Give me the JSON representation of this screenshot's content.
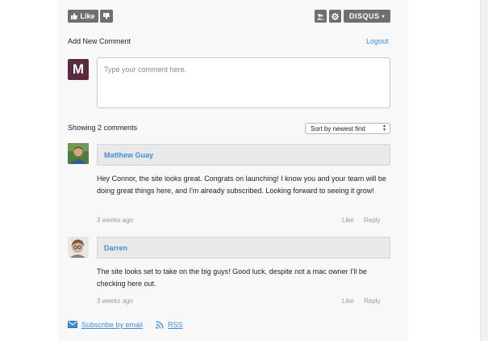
{
  "toolbar": {
    "like_label": "Like",
    "disqus_label": "DISQUS"
  },
  "header": {
    "add_comment": "Add New Comment",
    "logout": "Logout"
  },
  "composer": {
    "avatar_letter": "M",
    "placeholder": "Type your comment here."
  },
  "comments_header": {
    "count_text": "Showing 2 comments",
    "sort_selected": "Sort by newest first"
  },
  "comments": [
    {
      "author": "Matthew Guay",
      "text": "Hey Connor, the site looks great. Congrats on launching! I know you and your team will be doing great things here, and I'm already subscribed. Looking forward to seeing it grow!",
      "time": "3 weeks ago",
      "like": "Like",
      "reply": "Reply"
    },
    {
      "author": "Darren",
      "text": "The site looks set to take on the big guys! Good luck, despite not a mac owner I'll be checking here out.",
      "time": "3 weeks ago",
      "like": "Like",
      "reply": "Reply"
    }
  ],
  "footer": {
    "subscribe": "Subscribe by email",
    "rss": "RSS"
  },
  "colors": {
    "link": "#3d8fd9",
    "toolbar_button": "#6f6f6f",
    "avatar_m": "#5a2a3f"
  }
}
